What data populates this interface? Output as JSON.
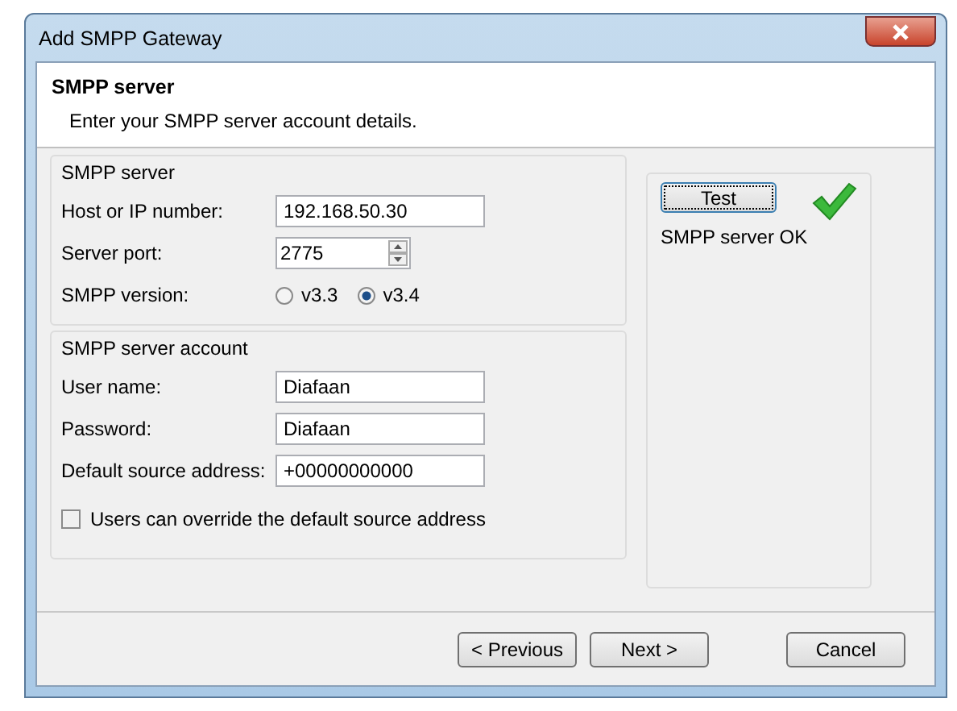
{
  "window": {
    "title": "Add SMPP Gateway"
  },
  "header": {
    "title": "SMPP server",
    "subtitle": "Enter your SMPP server account details."
  },
  "server_group": {
    "title": "SMPP server",
    "host_label": "Host or IP number:",
    "host_value": "192.168.50.30",
    "port_label": "Server port:",
    "port_value": "2775",
    "version_label": "SMPP version:",
    "versions": [
      {
        "label": "v3.3",
        "selected": false
      },
      {
        "label": "v3.4",
        "selected": true
      }
    ]
  },
  "account_group": {
    "title": "SMPP server account",
    "fields": [
      {
        "label": "User name:",
        "value": "Diafaan"
      },
      {
        "label": "Password:",
        "value": "Diafaan"
      },
      {
        "label": "Default source address:",
        "value": "+00000000000"
      }
    ],
    "override": {
      "label": "Users can override the default source address",
      "checked": false
    }
  },
  "test_panel": {
    "button": "Test",
    "status": "SMPP server OK",
    "ok": true
  },
  "buttons": [
    {
      "label": "< Previous",
      "kind": "nav"
    },
    {
      "label": "Next >",
      "kind": "nav"
    },
    {
      "label": "Cancel",
      "kind": "cancel"
    }
  ]
}
